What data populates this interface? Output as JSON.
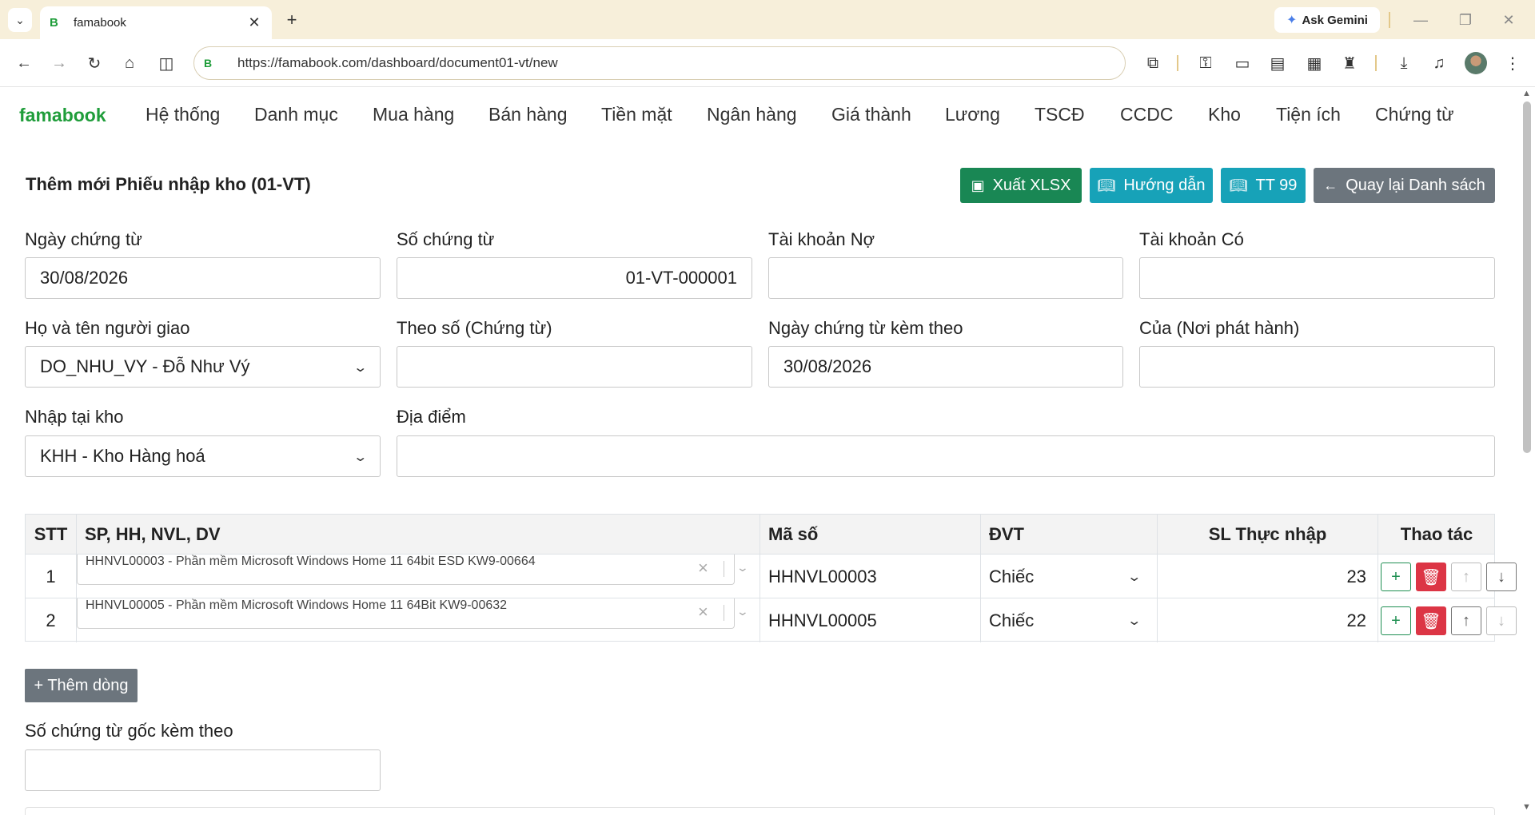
{
  "browser": {
    "tab_title": "famabook",
    "tab_favicon": "B",
    "url": "https://famabook.com/dashboard/document01-vt/new",
    "url_icon": "B",
    "gemini_label": "Ask Gemini",
    "icons": {
      "tab_menu": "chevron-down-icon",
      "back": "back-arrow-icon",
      "forward": "forward-arrow-icon",
      "reload": "reload-icon",
      "home": "home-icon",
      "split": "split-view-icon"
    }
  },
  "app": {
    "brand": "famabook",
    "nav": [
      "Hệ thống",
      "Danh mục",
      "Mua hàng",
      "Bán hàng",
      "Tiền mặt",
      "Ngân hàng",
      "Giá thành",
      "Lương",
      "TSCĐ",
      "CCDC",
      "Kho",
      "Tiện ích",
      "Chứng từ"
    ],
    "page_title": "Thêm mới Phiếu nhập kho (01-VT)",
    "actions": {
      "export": "Xuất XLSX",
      "guide": "Hướng dẫn",
      "tt99": "TT 99",
      "back": "Quay lại Danh sách"
    },
    "colors": {
      "brand": "#1f9d3a",
      "export": "#198754",
      "info": "#17a2b8",
      "secondary": "#6c757d",
      "danger": "#dc3545"
    },
    "form": {
      "ngay_chung_tu": {
        "label": "Ngày chứng từ",
        "value": "30/08/2026"
      },
      "so_chung_tu": {
        "label": "Số chứng từ",
        "value": "01-VT-000001"
      },
      "tk_no": {
        "label": "Tài khoản Nợ",
        "value": ""
      },
      "tk_co": {
        "label": "Tài khoản Có",
        "value": ""
      },
      "nguoi_giao": {
        "label": "Họ và tên người giao",
        "value": "DO_NHU_VY - Đỗ Như Vý"
      },
      "theo_so": {
        "label": "Theo số (Chứng từ)",
        "value": ""
      },
      "ngay_kem_theo": {
        "label": "Ngày chứng từ kèm theo",
        "value": "30/08/2026"
      },
      "cua": {
        "label": "Của (Nơi phát hành)",
        "value": ""
      },
      "kho": {
        "label": "Nhập tại kho",
        "value": "KHH - Kho Hàng hoá"
      },
      "dia_diem": {
        "label": "Địa điểm",
        "value": ""
      },
      "so_goc": {
        "label": "Số chứng từ gốc kèm theo",
        "value": ""
      }
    },
    "table": {
      "headers": [
        "STT",
        "SP, HH, NVL, DV",
        "Mã số",
        "ĐVT",
        "SL Thực nhập",
        "Thao tác"
      ],
      "rows": [
        {
          "stt": "1",
          "product": "HHNVL00003 - Phần mềm Microsoft Windows Home 11 64bit ESD KW9-00664",
          "code": "HHNVL00003",
          "unit": "Chiếc",
          "qty": "23"
        },
        {
          "stt": "2",
          "product": "HHNVL00005 - Phần mềm Microsoft Windows Home 11 64Bit KW9-00632",
          "code": "HHNVL00005",
          "unit": "Chiếc",
          "qty": "22"
        }
      ]
    },
    "add_row": "+ Thêm dòng"
  }
}
